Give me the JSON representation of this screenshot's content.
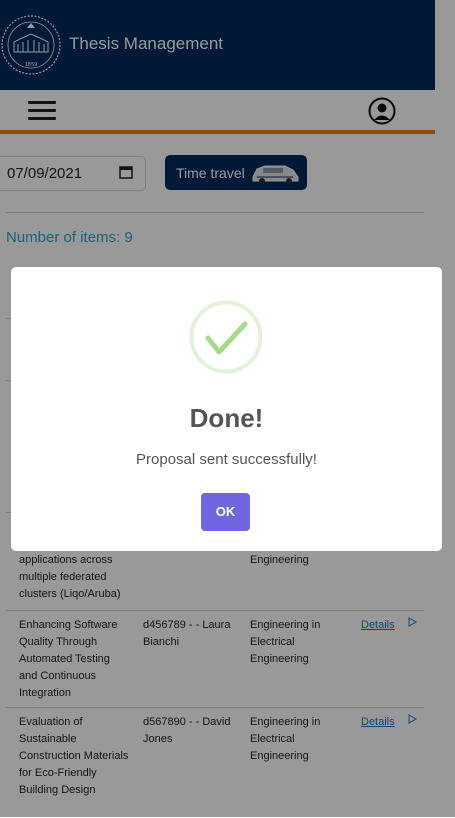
{
  "header": {
    "title": "Thesis Management",
    "logo_year": "1859"
  },
  "controls": {
    "date_value": "07/09/2021",
    "time_travel_label": "Time travel",
    "items_count_text": "Number of items: 9"
  },
  "table": {
    "fragment_title": "applications across multiple federated clusters (Liqo/Aruba)",
    "fragment_dept": "Engineering",
    "rows": [
      {
        "title": "Enhancing Software Quality Through Automated Testing and Continuous Integration",
        "supervisor": "d456789 - - Laura Bianchi",
        "department": "Engineering in Electrical Engineering",
        "link": "Details"
      },
      {
        "title": "Evaluation of Sustainable Construction Materials for Eco-Friendly Building Design",
        "supervisor": "d567890 - - David Jones",
        "department": "Engineering in Electrical Engineering",
        "link": "Details"
      }
    ]
  },
  "modal": {
    "title": "Done!",
    "message": "Proposal sent successfully!",
    "ok_label": "OK"
  },
  "colors": {
    "header": "#002b5c",
    "accent_orange": "#f07c00",
    "ok_button": "#7066e0",
    "success_green": "#a5dc86"
  }
}
